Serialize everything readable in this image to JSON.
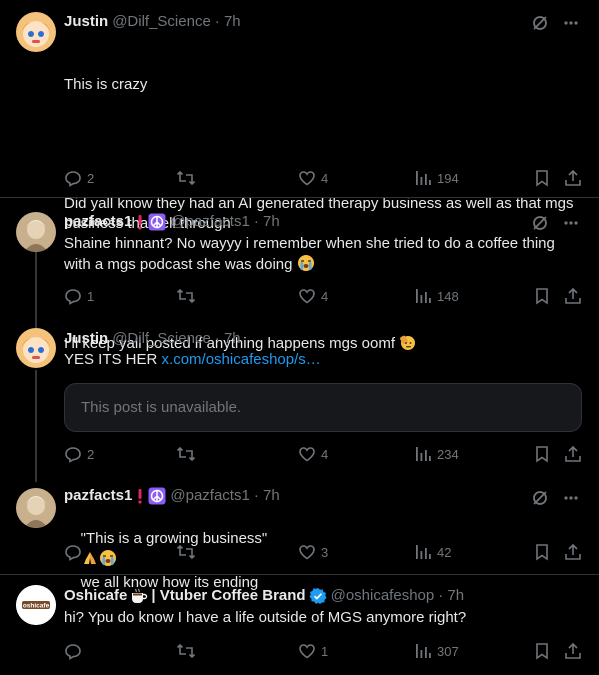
{
  "colors": {
    "background": "#000000",
    "text": "#e7e9ea",
    "muted": "#71767b",
    "link": "#1d9bf0",
    "verified": "#1d9bf0",
    "border": "#2f3336"
  },
  "posts": [
    {
      "name": "Justin",
      "handle": "@Dilf_Science",
      "time": "· 7h",
      "lines": [
        "This is crazy",
        "",
        "Did yall know they had an AI generated therapy business as well as that mgs business that fell through",
        "",
        "I’ll keep yall posted if anything happens mgs oomf"
      ],
      "emoji_end": "salute-face-emoji",
      "replies": "2",
      "reposts": "",
      "likes": "4",
      "views": "194"
    },
    {
      "name": "pazfacts1",
      "badges": [
        "red-exclamation-emoji",
        "peace-symbol-emoji"
      ],
      "handle": "@pazfacts1",
      "time": "· 7h",
      "text": "Shaine hinnant? No wayyy i remember when she tried to do a coffee thing with a mgs podcast she was doing",
      "emoji_end": "loudly-crying-face-emoji",
      "replies": "1",
      "reposts": "",
      "likes": "4",
      "views": "148"
    },
    {
      "name": "Justin",
      "handle": "@Dilf_Science",
      "time": "· 7h",
      "text": "YES ITS HER",
      "link": "x.com/oshicafeshop/s…",
      "quote_unavailable": "This post is unavailable.",
      "replies": "2",
      "reposts": "",
      "likes": "4",
      "views": "234"
    },
    {
      "name": "pazfacts1",
      "badges": [
        "red-exclamation-emoji",
        "peace-symbol-emoji"
      ],
      "handle": "@pazfacts1",
      "time": "· 7h",
      "text_before": "\"This is a growing business\"",
      "emojis": [
        "folded-hands-emoji",
        "loudly-crying-face-emoji"
      ],
      "text_after": "we all know how its ending",
      "replies": "",
      "reposts": "",
      "likes": "3",
      "views": "42"
    },
    {
      "name": "Oshicafe",
      "name_suffix": "| Vtuber Coffee Brand",
      "name_emoji": "coffee-emoji",
      "verified": true,
      "handle": "@oshicafeshop",
      "time": "· 7h",
      "text": "hi? Ypu do know I have a life outside of MGS anymore right?",
      "avatar_text": "oshicafe",
      "replies": "",
      "reposts": "",
      "likes": "1",
      "views": "307"
    }
  ]
}
